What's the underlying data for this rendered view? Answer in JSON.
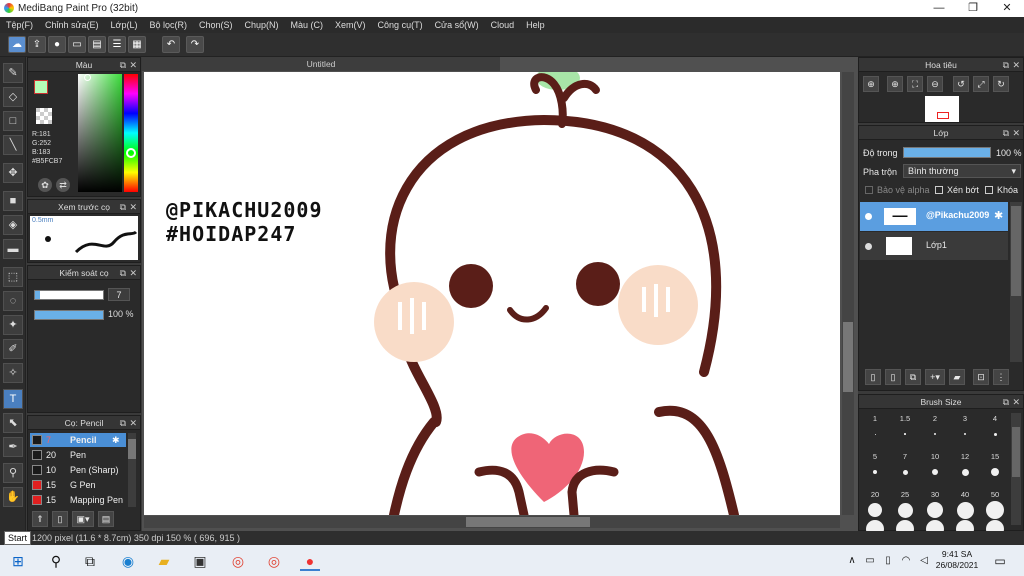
{
  "window": {
    "title": "MediBang Paint Pro (32bit)",
    "min": "—",
    "max": "❐",
    "close": "✕"
  },
  "menu": [
    "Tệp(F)",
    "Chỉnh sửa(E)",
    "Lớp(L)",
    "Bộ lọc(R)",
    "Chọn(S)",
    "Chụp(N)",
    "Màu (C)",
    "Xem(V)",
    "Công cụ(T)",
    "Cửa sổ(W)",
    "Cloud",
    "Help"
  ],
  "color_panel": {
    "title": "Màu",
    "r": "R:181",
    "g": "G:252",
    "b": "B:183",
    "hex": "#B5FCB7",
    "fg": "#B5FCB7"
  },
  "brush_preview": {
    "title": "Xem trước cọ",
    "size": "0.5mm"
  },
  "brush_control": {
    "title": "Kiểm soát cọ",
    "size_value": "7",
    "opacity_value": "100 %"
  },
  "brush_list": {
    "title": "Cọ: Pencil",
    "items": [
      {
        "size": "7",
        "name": "Pencil",
        "color": "#1a1a1a",
        "active": true
      },
      {
        "size": "20",
        "name": "Pen",
        "color": "#1a1a1a",
        "active": false
      },
      {
        "size": "10",
        "name": "Pen (Sharp)",
        "color": "#1a1a1a",
        "active": false
      },
      {
        "size": "15",
        "name": "G Pen",
        "color": "#e02020",
        "active": false
      },
      {
        "size": "15",
        "name": "Mapping Pen",
        "color": "#e02020",
        "active": false
      }
    ]
  },
  "canvas": {
    "tab": "Untitled",
    "text1": "@PIKACHU2009",
    "text2": "#HOIDAP247"
  },
  "navigator": {
    "title": "Hoa tiêu"
  },
  "layers": {
    "title": "Lớp",
    "opacity_label": "Độ trong",
    "opacity_value": "100 %",
    "blend_label": "Pha trộn",
    "blend_value": "Bình thường",
    "protect_alpha": "Bảo vệ alpha",
    "clip": "Xén bớt",
    "lock": "Khóa",
    "items": [
      {
        "name": "@Pikachu2009",
        "active": true
      },
      {
        "name": "Lớp1",
        "active": false
      }
    ]
  },
  "brush_size": {
    "title": "Brush Size",
    "labels": [
      "1",
      "1.5",
      "2",
      "3",
      "4",
      "5",
      "7",
      "10",
      "12",
      "15",
      "20",
      "25",
      "30",
      "40",
      "50"
    ]
  },
  "status": {
    "text": "1200 pixel  (11.6 * 8.7cm)  350 dpi  150 %  ( 696, 915 )",
    "start_tooltip": "Start"
  },
  "taskbar": {
    "time": "9:41 SA",
    "date": "26/08/2021"
  }
}
